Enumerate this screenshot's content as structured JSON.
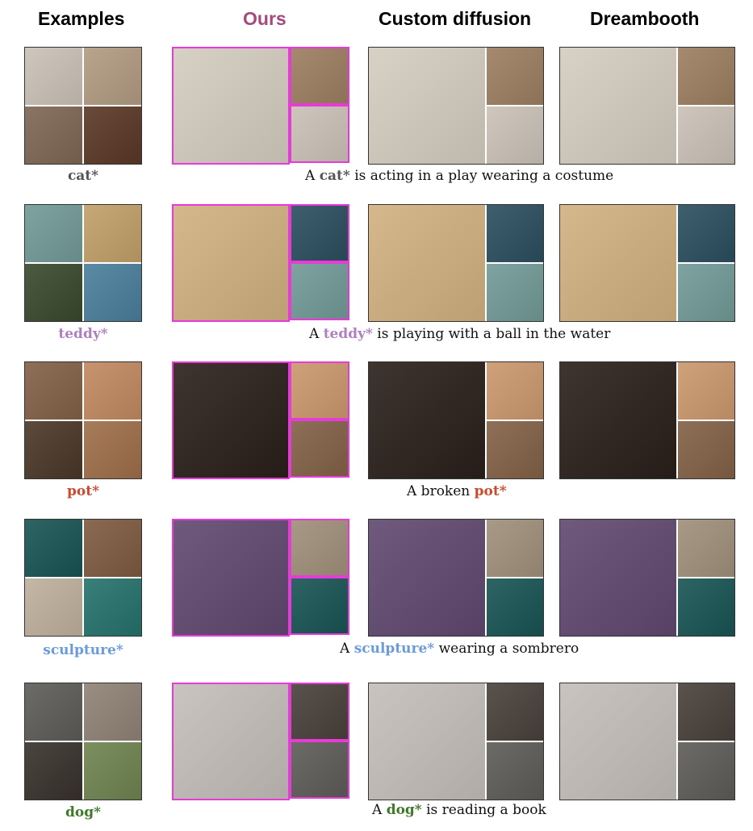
{
  "headers": {
    "examples": "Examples",
    "ours": "Ours",
    "custom_diffusion": "Custom diffusion",
    "dreambooth": "Dreambooth"
  },
  "colors": {
    "ours_header": "#a54a7f",
    "ours_border": "#e83ad8",
    "cat": "#555555",
    "teddy": "#b07fc0",
    "pot": "#c94a2c",
    "sculpture": "#6a9bdc",
    "dog": "#3f7a2a"
  },
  "rows": [
    {
      "token": "cat*",
      "caption_pre": "A ",
      "caption_token": "cat*",
      "caption_post": " is acting in a play wearing a costume",
      "palette": [
        "#cfc7bd",
        "#b9a48e",
        "#8a7464",
        "#6a4b3b",
        "#d8d1c5",
        "#a58a6f"
      ]
    },
    {
      "token": "teddy*",
      "caption_pre": "A ",
      "caption_token": "teddy*",
      "caption_post": " is playing with a ball in the water",
      "palette": [
        "#7fa3a0",
        "#c7a877",
        "#4b5a41",
        "#5b8aa5",
        "#d5b88c",
        "#3f5f6e"
      ]
    },
    {
      "token": "pot*",
      "caption_pre": "A broken ",
      "caption_token": "pot*",
      "caption_post": "",
      "palette": [
        "#8e7058",
        "#c79470",
        "#5c4a3d",
        "#a77c5a",
        "#3f3530",
        "#d0a27b"
      ]
    },
    {
      "token": "sculpture*",
      "caption_pre": "A ",
      "caption_token": "sculpture*",
      "caption_post": " wearing a sombrero",
      "palette": [
        "#2f6464",
        "#8a6a52",
        "#c4b7a6",
        "#3b7f7b",
        "#6f5a7d",
        "#a89a86"
      ]
    },
    {
      "token": "dog*",
      "caption_pre": "A ",
      "caption_token": "dog*",
      "caption_post": " is reading a book",
      "palette": [
        "#6d6b68",
        "#9a8e83",
        "#4b4540",
        "#7c8f60",
        "#c9c4bf",
        "#5a534d"
      ]
    }
  ]
}
